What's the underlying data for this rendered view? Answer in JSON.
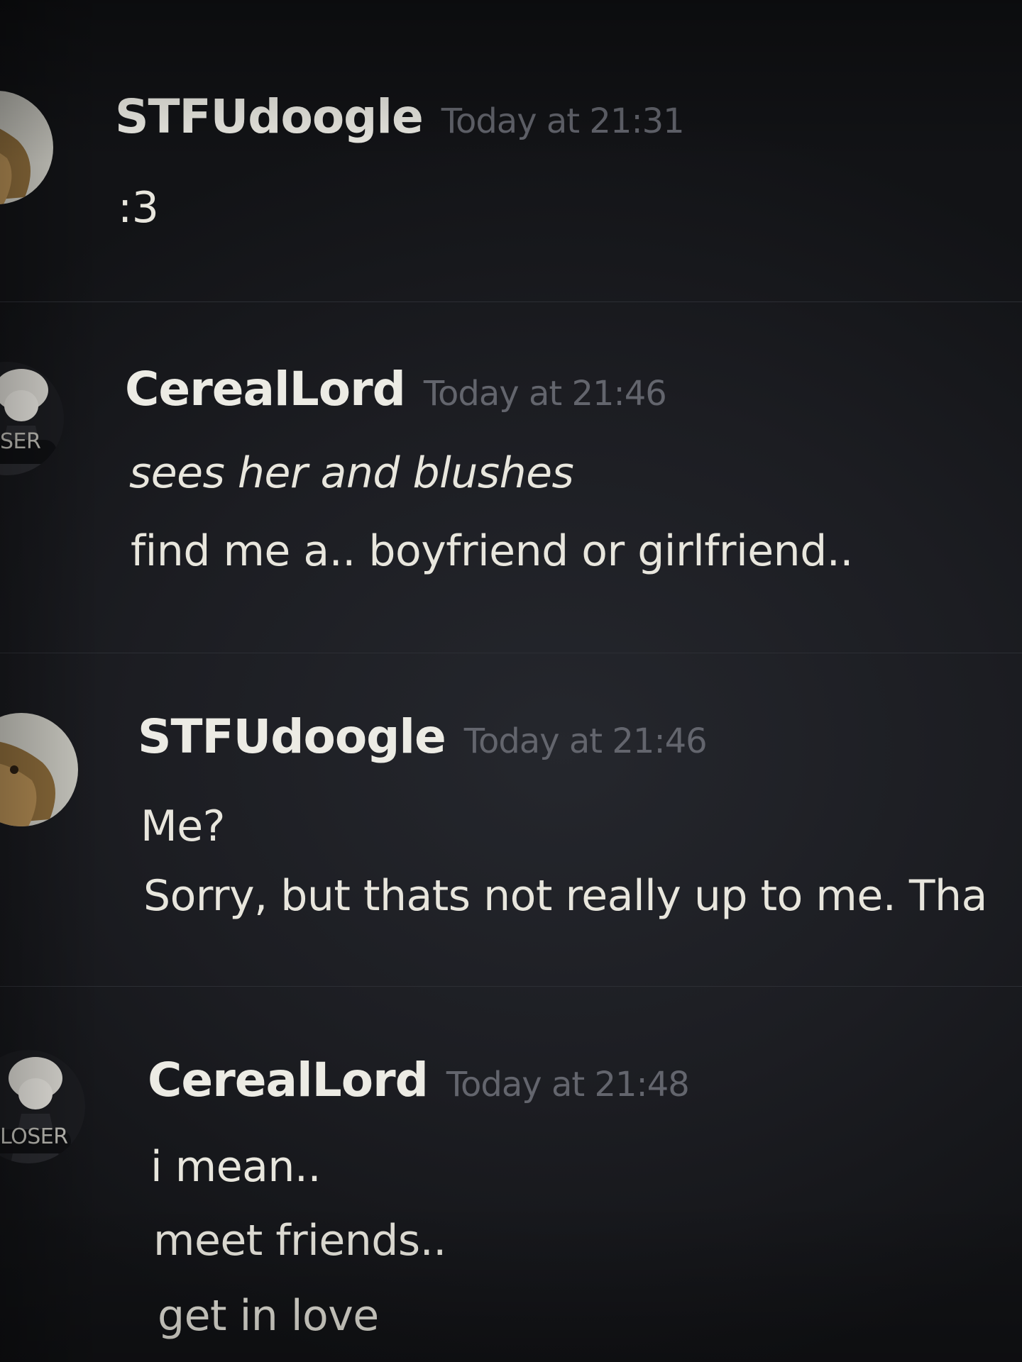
{
  "messages": [
    {
      "username": "STFUdoogle",
      "timestamp": "Today at 21:31",
      "lines": [
        ":3"
      ]
    },
    {
      "username": "CerealLord",
      "timestamp": "Today at 21:46",
      "lines": [
        "sees her and blushes",
        "find me a.. boyfriend or girlfriend.."
      ],
      "avatar_badge": "SER"
    },
    {
      "username": "STFUdoogle",
      "timestamp": "Today at 21:46",
      "lines": [
        "Me?",
        "Sorry, but thats not really up to me. Tha"
      ]
    },
    {
      "username": "CerealLord",
      "timestamp": "Today at 21:48",
      "lines": [
        "i mean..",
        "meet friends..",
        "get in love"
      ],
      "avatar_badge": "LOSER"
    }
  ],
  "colors": {
    "background": "#1e1f24",
    "username": "#ecebe4",
    "timestamp": "#63656d",
    "message_text": "#e8e6dd"
  },
  "icons": {
    "stfudoogle_avatar": "dog-photo-avatar",
    "cereallord_avatar": "anime-character-avatar"
  }
}
